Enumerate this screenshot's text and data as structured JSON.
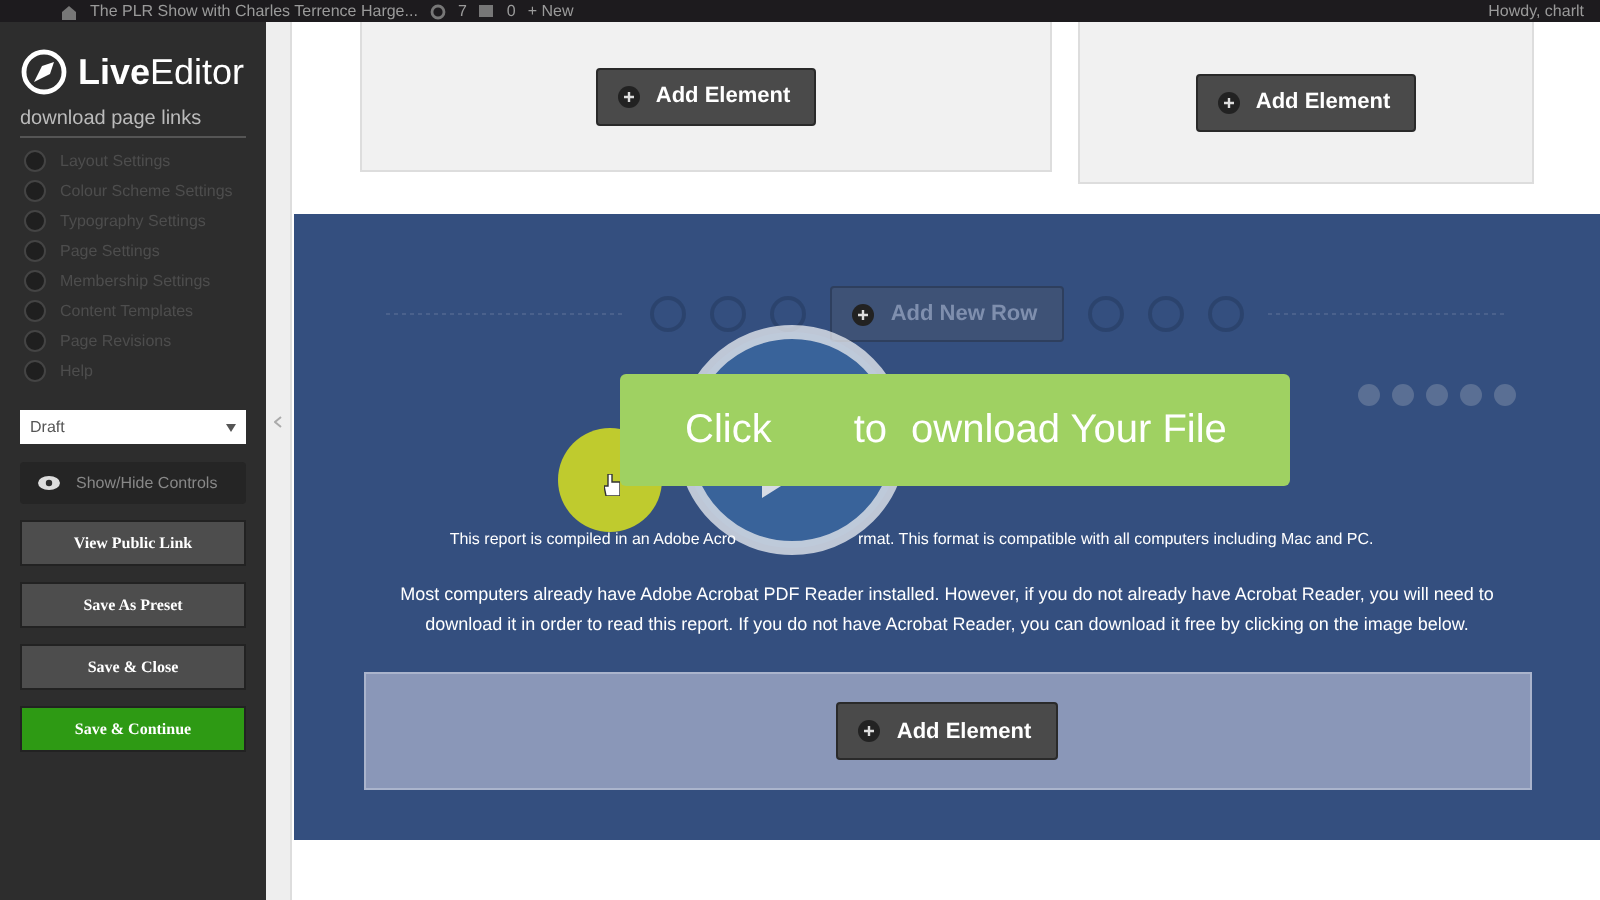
{
  "admin_bar": {
    "site_title": "The PLR Show with Charles Terrence Harge...",
    "updates": "7",
    "comments": "0",
    "new": "+ New",
    "greeting": "Howdy, charlt"
  },
  "sidebar": {
    "logo": "**Live**Editor",
    "page_name": "download page links",
    "menu": [
      {
        "label": "Layout Settings"
      },
      {
        "label": "Colour Scheme Settings"
      },
      {
        "label": "Typography Settings"
      },
      {
        "label": "Page Settings"
      },
      {
        "label": "Membership Settings"
      },
      {
        "label": "Content Templates"
      },
      {
        "label": "Page Revisions"
      },
      {
        "label": "Help"
      }
    ],
    "status": {
      "value": "Draft"
    },
    "toggle": "Show/Hide Controls",
    "buttons": [
      {
        "label": "View Public Link",
        "kind": "default"
      },
      {
        "label": "Save As Preset",
        "kind": "default"
      },
      {
        "label": "Save & Close",
        "kind": "default"
      },
      {
        "label": "Save & Continue",
        "kind": "primary"
      }
    ]
  },
  "canvas": {
    "top_boxes": [
      {
        "button": "Add Element"
      },
      {
        "button": "Add Element"
      }
    ],
    "section": {
      "add_row": "Add New Row",
      "download_button": {
        "parts": [
          "Click",
          "to",
          "ownload Your File"
        ]
      },
      "paragraphs": [
        {
          "parts": [
            "This report is compiled in an Adobe Acro",
            "rmat.   This format is compatible with all computers including Mac and PC."
          ]
        },
        {
          "parts": [
            "Most computers already have Adobe Acrobat PDF Reader installed.  However, if you do not already have Acrobat Reader, you will need to download it in order to read this report. If you do not have Acrobat Reader, you can download it free by clicking on the image below."
          ]
        }
      ],
      "element_box": {
        "button": "Add Element"
      }
    }
  }
}
